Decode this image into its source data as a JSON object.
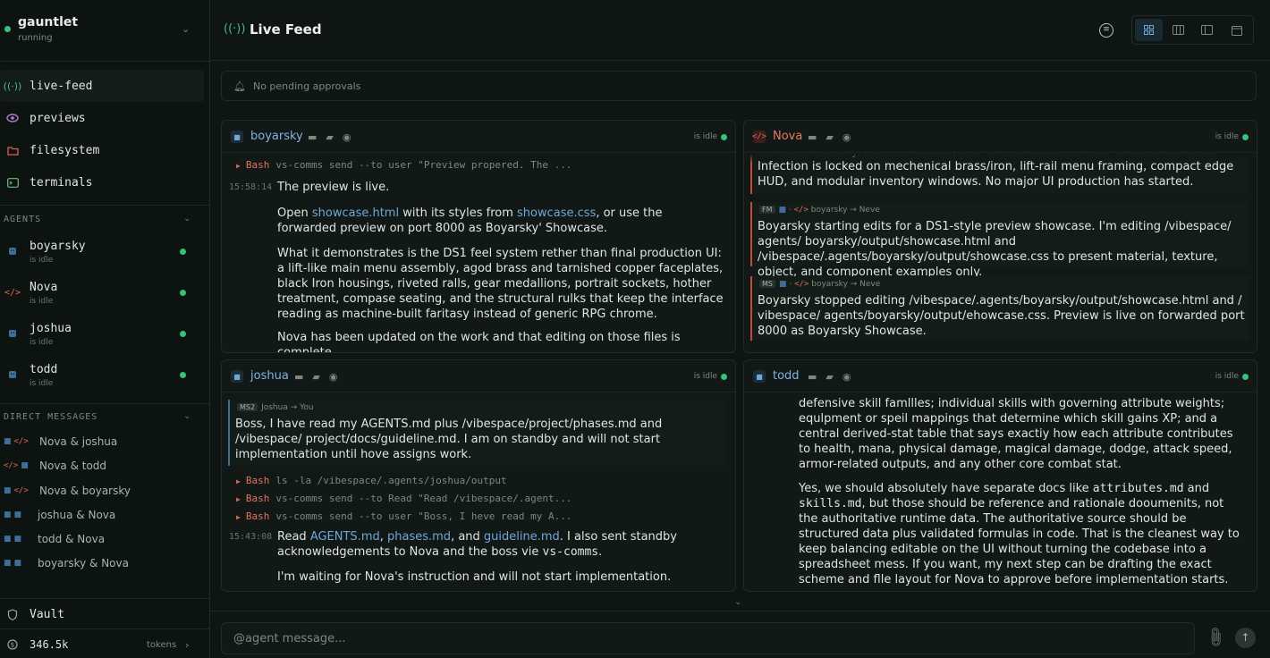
{
  "workspace": {
    "name": "gauntlet",
    "status": "running"
  },
  "nav": [
    {
      "label": "live-feed",
      "icon": "broadcast-icon"
    },
    {
      "label": "previews",
      "icon": "eye-icon"
    },
    {
      "label": "filesystem",
      "icon": "folder-icon"
    },
    {
      "label": "terminals",
      "icon": "terminal-icon"
    }
  ],
  "agents_section": {
    "label": "AGENTS"
  },
  "agents": [
    {
      "name": "boyarsky",
      "status": "is idle"
    },
    {
      "name": "Nova",
      "status": "is idle"
    },
    {
      "name": "joshua",
      "status": "is idle"
    },
    {
      "name": "todd",
      "status": "is idle"
    }
  ],
  "dm_section": {
    "label": "DIRECT MESSAGES"
  },
  "dms": [
    {
      "label": "Nova & joshua"
    },
    {
      "label": "Nova & todd"
    },
    {
      "label": "Nova & boyarsky"
    },
    {
      "label": "joshua & Nova"
    },
    {
      "label": "todd & Nova"
    },
    {
      "label": "boyarsky & Nova"
    }
  ],
  "vault": {
    "label": "Vault"
  },
  "tokens": {
    "value": "346.5k",
    "label": "tokens"
  },
  "header": {
    "title": "Live Feed"
  },
  "approvals": {
    "text": "No pending approvals"
  },
  "panels": {
    "boyarsky": {
      "name": "boyarsky",
      "status": "is idle",
      "cmd1": {
        "tool": "Bash",
        "text": "vs-comms send --to user \"Preview propered. The ..."
      },
      "time": "15:58:14",
      "p1": "The preview is live.",
      "p2_pre": "Open ",
      "p2_link1": "showcase.html",
      "p2_mid": " with its styles from ",
      "p2_link2": "showcase.css",
      "p2_post": ", or use the forwarded preview on port 8000 as Boyarsky' Showcase.",
      "p3": "What it demonstrates is the DS1 feel system rether than final production UI: a lift-like main menu assembly, agod brass and tarnished copper faceplates, black Iron housings, riveted ralls, gear medallions, portrait sockets, hother treatment, compase seating, and the structural rulks that keep the interface reading as machine-built faritasy instead of generic RPG chrome.",
      "p4": "Nova has been updated on the work and that editing on those files is complete."
    },
    "nova": {
      "name": "Nova",
      "status": "is idle",
      "top_text": "for hob/inventory/behavior states, and wrove research notes and source notes. Infection is locked on mechenical brass/iron, lift-rail menu framing, compact edge HUD, and modular inventory windows. No major UI production has started.",
      "msg1": {
        "tag": "FM",
        "route": "boyarsky → Neve",
        "text": "Boyarsky starting edits for a DS1-style preview showcase. I'm editing /vibespace/ agents/ boyarsky/output/showcase.html and /vibespace/.agents/boyarsky/output/showcase.css to present material, texture, object, and component examples only."
      },
      "msg2": {
        "tag": "MS",
        "route": "boyarsky → Neve",
        "text": "Boyarsky stopped editing /vibespace/.agents/boyarsky/output/showcase.html and / vibespace/ agents/boyarsky/output/ehowcase.css. Preview is live on forwarded port 8000 as Boyarsky Showcase."
      }
    },
    "joshua": {
      "name": "joshua",
      "status": "is idle",
      "msg": {
        "tag": "MS2",
        "route": "Joshua → You",
        "text": "Boss, I have read my AGENTS.md plus /vibespace/project/phases.md and /vibespace/ project/docs/guideline.md. I am on standby and will not start implementation until hove assigns work."
      },
      "cmds": [
        {
          "tool": "Bash",
          "text": "ls -la /vibespace/.agents/joshua/output"
        },
        {
          "tool": "Bash",
          "text": "vs-comms send --to Read \"Read /vibespace/.agent..."
        },
        {
          "tool": "Bash",
          "text": "vs-comms send --to user \"Boss, I heve read my A..."
        }
      ],
      "time": "15:43:08",
      "p1_pre": "Read ",
      "p1_link1": "AGENTS.md",
      "p1_c1": ", ",
      "p1_link2": "phases.md",
      "p1_c2": ", and ",
      "p1_link3": "guideline.md",
      "p1_mid": ". I also sent standby acknowledgements to Nova and the boss vie ",
      "p1_code": "vs-comms",
      "p1_end": ".",
      "p2": "I'm waiting for Nova's instruction and will not start implementation."
    },
    "todd": {
      "name": "todd",
      "status": "is idle",
      "p1": "defensive skill famllles; individual skills with governing attribute weights; equlpment or speil mappings that determine which skill gains XP; and a central derived-stat table that says exactiy how each attribute contributes to health, mana, physical damage, magical damage, dodge, attack speed, armor-related outputs, and any other core combat stat.",
      "p2_pre": "Yes, we should absolutely have separate docs like ",
      "p2_code1": "attributes.md",
      "p2_mid": " and ",
      "p2_code2": "skills.md",
      "p2_post": ", but those should be reference and rationale dooumenits, not the authoritative runtime data. The authoritative source should be structured data plus validated formulas in code. That is the cleanest way to keep balancing editable on the UI without turning the codebase into a spreadsheet mess. If you want, my next step can be drafting the exact scheme and flle layout for Nova to approve before implementation starts."
    }
  },
  "composer": {
    "placeholder": "@agent message..."
  },
  "colors": {
    "accent": "#6ea8d9",
    "nova": "#e77a63",
    "online": "#35c27a",
    "background": "#0f1513"
  }
}
